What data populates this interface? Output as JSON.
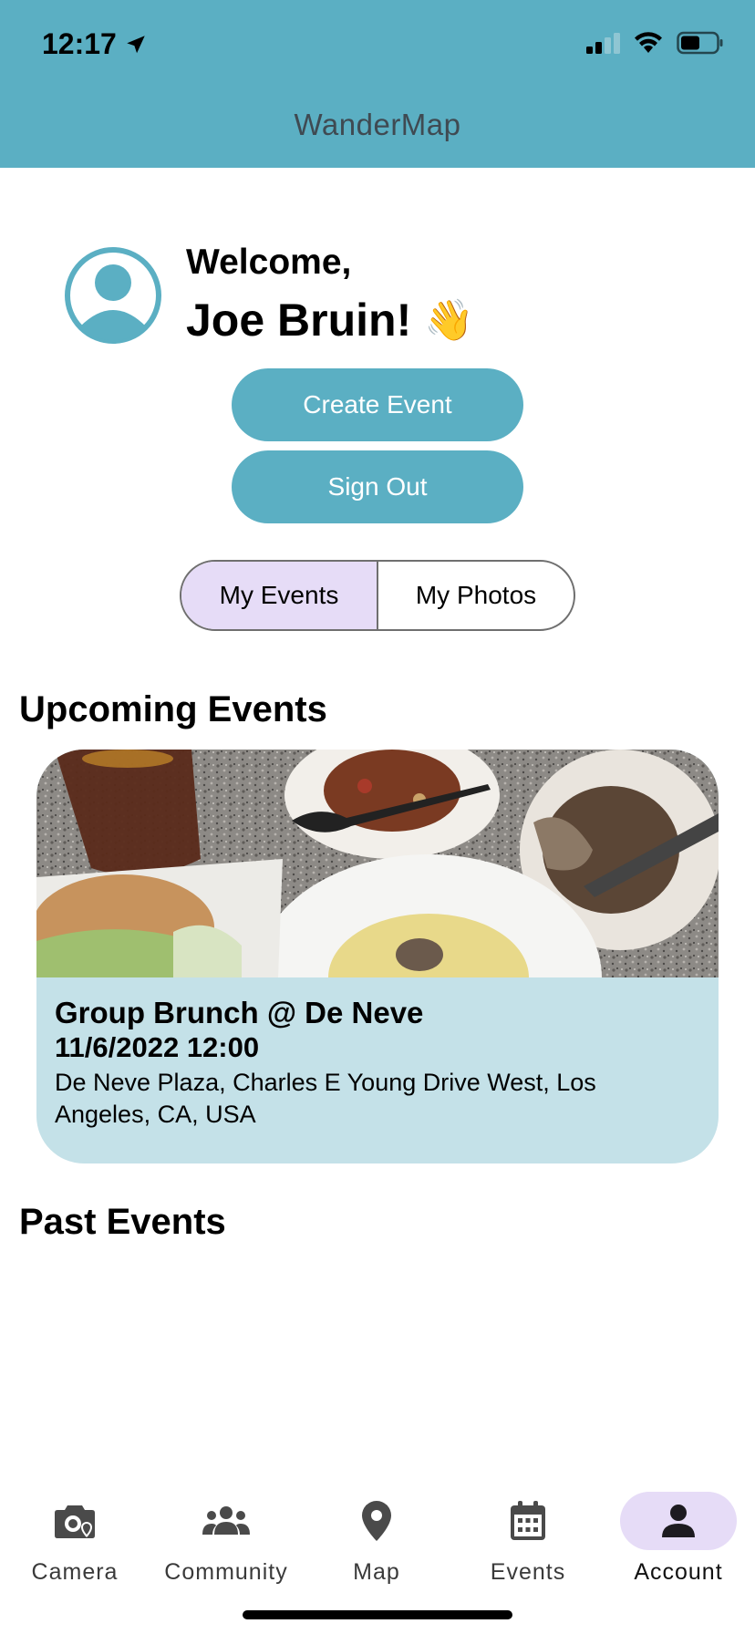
{
  "status_bar": {
    "time": "12:17"
  },
  "header": {
    "title": "WanderMap"
  },
  "profile": {
    "welcome": "Welcome,",
    "name": "Joe Bruin!",
    "emoji": "👋"
  },
  "actions": {
    "create_event": "Create Event",
    "sign_out": "Sign Out"
  },
  "segments": {
    "items": [
      "My Events",
      "My Photos"
    ],
    "selected": "My Events"
  },
  "sections": {
    "upcoming": "Upcoming Events",
    "past": "Past Events"
  },
  "upcoming_events": [
    {
      "title": "Group Brunch @ De Neve",
      "datetime": "11/6/2022 12:00",
      "location": "De Neve Plaza, Charles E Young Drive West, Los Angeles, CA, USA"
    }
  ],
  "tab_bar": {
    "items": [
      {
        "label": "Camera",
        "icon": "camera-icon"
      },
      {
        "label": "Community",
        "icon": "community-icon"
      },
      {
        "label": "Map",
        "icon": "map-pin-icon"
      },
      {
        "label": "Events",
        "icon": "calendar-icon"
      },
      {
        "label": "Account",
        "icon": "account-icon"
      }
    ],
    "selected": "Account"
  },
  "colors": {
    "accent": "#5bafc3",
    "selected_tint": "#e6dcf7",
    "card_bg": "#c4e1e8"
  }
}
